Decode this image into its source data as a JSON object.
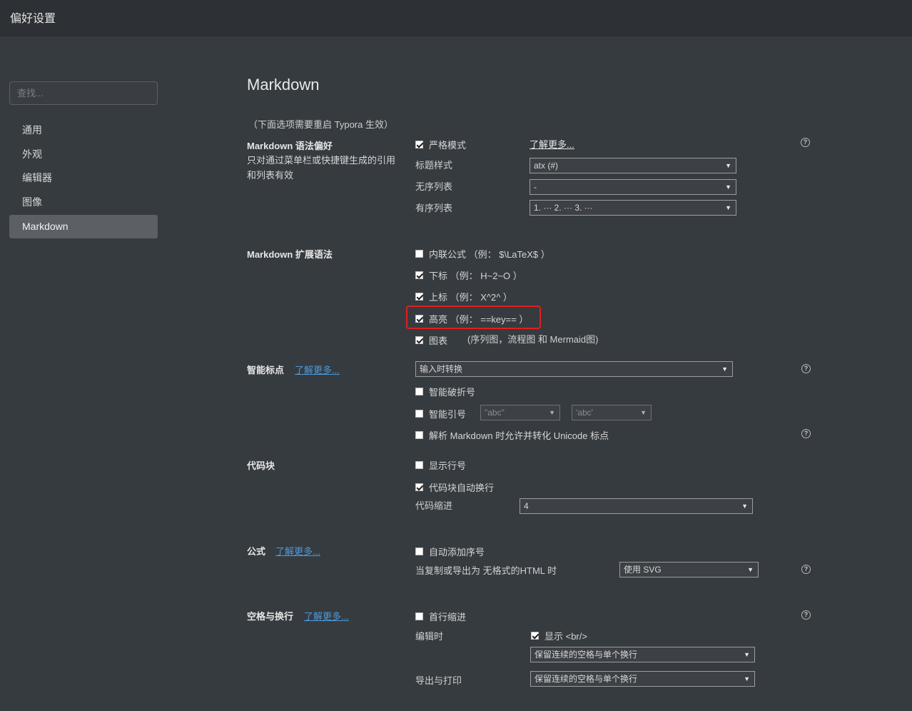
{
  "window": {
    "title": "偏好设置"
  },
  "sidebar": {
    "search_placeholder": "查找...",
    "items": [
      {
        "label": "通用"
      },
      {
        "label": "外观"
      },
      {
        "label": "编辑器"
      },
      {
        "label": "图像"
      },
      {
        "label": "Markdown",
        "active": true
      }
    ]
  },
  "main": {
    "title": "Markdown",
    "restart_note": "（下面选项需要重启 Typora 生效）",
    "syntax_pref": {
      "title": "Markdown 语法偏好",
      "desc": "只对通过菜单栏或快捷键生成的引用和列表有效",
      "strict_mode": "严格模式",
      "strict_checked": true,
      "learn_more": "了解更多...",
      "heading_label": "标题样式",
      "heading_value": "atx (#)",
      "unordered_label": "无序列表",
      "unordered_value": "-",
      "ordered_label": "有序列表",
      "ordered_value": "1. ··· 2. ··· 3. ···"
    },
    "ext_syntax": {
      "title": "Markdown 扩展语法",
      "inline_math": "内联公式 （例： $\\LaTeX$ ）",
      "subscript": "下标 （例： H~2~O ）",
      "superscript": "上标 （例： X^2^ ）",
      "highlight": "高亮 （例： ==key== ）",
      "diagrams": "图表",
      "diagrams_note": "(序列图，流程图 和 Mermaid图)"
    },
    "smart_punct": {
      "title": "智能标点",
      "learn_more": "了解更多...",
      "mode_value": "输入时转换",
      "smart_dash": "智能破折号",
      "smart_quotes": "智能引号",
      "double_quote": "\"abc\"",
      "single_quote": "'abc'",
      "unicode_punct": "解析 Markdown 时允许并转化 Unicode 标点"
    },
    "code_block": {
      "title": "代码块",
      "line_numbers": "显示行号",
      "auto_wrap": "代码块自动换行",
      "indent_label": "代码缩进",
      "indent_value": "4"
    },
    "math": {
      "title": "公式",
      "learn_more": "了解更多...",
      "auto_number": "自动添加序号",
      "export_label": "当复制或导出为 无格式的HTML 时",
      "export_value": "使用 SVG"
    },
    "whitespace": {
      "title": "空格与换行",
      "learn_more": "了解更多...",
      "first_indent": "首行缩进",
      "editing_label": "编辑时",
      "show_br": "显示 <br/>",
      "editing_value": "保留连续的空格与单个换行",
      "export_label": "导出与打印",
      "export_value": "保留连续的空格与单个换行"
    }
  },
  "icons": {
    "help": "question-circle-icon",
    "dropdown": "triangle-down-icon",
    "checkbox": "checkbox-icon"
  },
  "colors": {
    "background": "#363b40",
    "titlebar": "#2d3034",
    "link": "#4e9ad8",
    "annotation": "#e0201a"
  }
}
